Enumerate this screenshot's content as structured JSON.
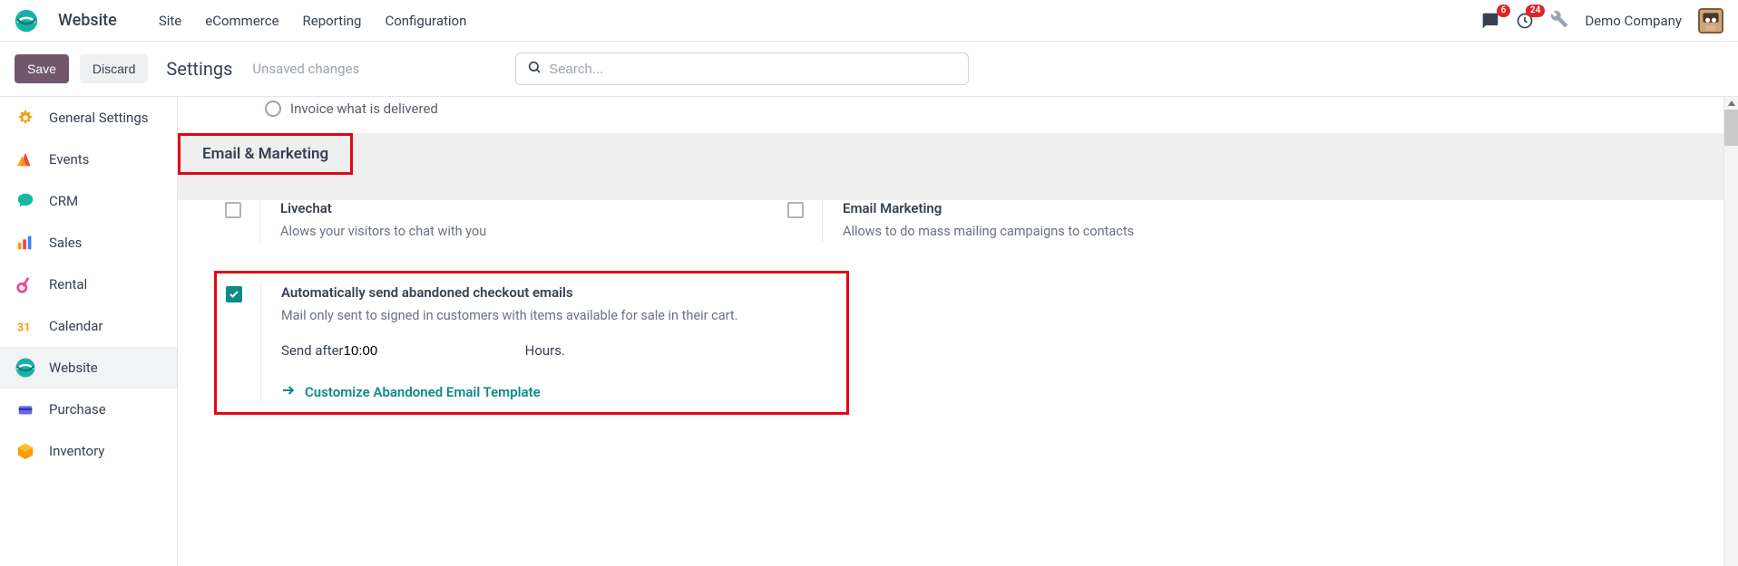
{
  "brand": "Website",
  "topnav": {
    "items": [
      "Site",
      "eCommerce",
      "Reporting",
      "Configuration"
    ]
  },
  "badges": {
    "messages": "6",
    "activities": "24"
  },
  "company": "Demo Company",
  "actionbar": {
    "save": "Save",
    "discard": "Discard",
    "title": "Settings",
    "status": "Unsaved changes"
  },
  "search": {
    "placeholder": "Search..."
  },
  "sidebar": {
    "items": [
      {
        "label": "General Settings"
      },
      {
        "label": "Events"
      },
      {
        "label": "CRM"
      },
      {
        "label": "Sales"
      },
      {
        "label": "Rental"
      },
      {
        "label": "Calendar"
      },
      {
        "label": "Website"
      },
      {
        "label": "Purchase"
      },
      {
        "label": "Inventory"
      }
    ],
    "active_index": 6
  },
  "truncated_option": "Invoice what is delivered",
  "section_title": "Email & Marketing",
  "settings": {
    "livechat": {
      "title": "Livechat",
      "desc": "Alows your visitors to chat with you",
      "checked": false
    },
    "email_marketing": {
      "title": "Email Marketing",
      "desc": "Allows to do mass mailing campaigns to contacts",
      "checked": false
    },
    "abandoned": {
      "title": "Automatically send abandoned checkout emails",
      "desc": "Mail only sent to signed in customers with items available for sale in their cart.",
      "checked": true,
      "send_after_label": "Send after",
      "send_after_value": "10:00",
      "send_after_unit": "Hours.",
      "link": "Customize Abandoned Email Template"
    }
  }
}
